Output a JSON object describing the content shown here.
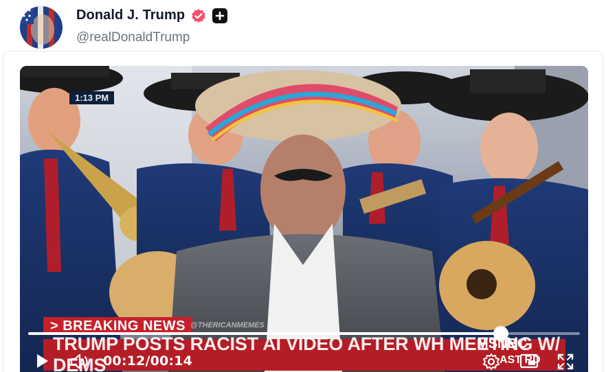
{
  "post": {
    "display_name": "Donald J. Trump",
    "handle": "@realDonaldTrump",
    "verified_icon": "verified-badge-icon",
    "plus_icon": "plus-badge-icon"
  },
  "video": {
    "overlay_time": "1:13 PM",
    "breaking": "> BREAKING NEWS",
    "watermark": "@THERICANMEMES",
    "headline": "TRUMP POSTS RACIST AI VIDEO AFTER WH MEETING W/ DEMS",
    "network": "MSNBC",
    "network_sub": "AST    RD",
    "progress": 0.857,
    "time_display": "00:12/00:14",
    "icons": [
      "play-icon",
      "volume-icon",
      "settings-icon",
      "picture-in-picture-icon",
      "fullscreen-icon"
    ]
  },
  "colors": {
    "verified": "#f4516c",
    "breaking_red": "#c8202a",
    "headline_red": "#b51d26"
  }
}
